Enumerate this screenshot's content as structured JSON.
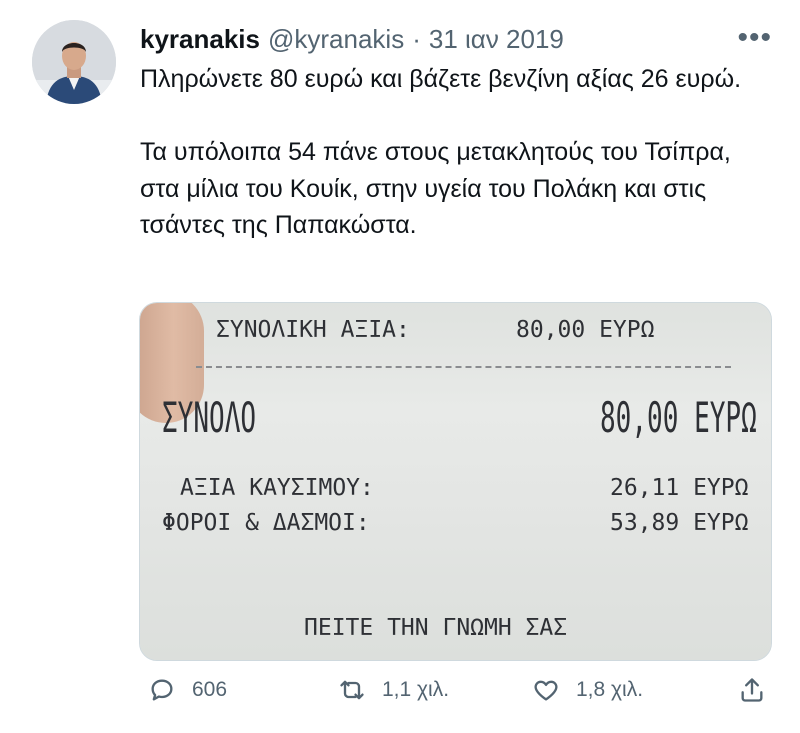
{
  "tweet": {
    "display_name": "kyranakis",
    "handle": "@kyranakis",
    "separator": "·",
    "date": "31 ιαν 2019",
    "more": "•••",
    "paragraphs": [
      "Πληρώνετε 80 ευρώ και βάζετε βενζίνη αξίας 26 ευρώ.",
      "Τα υπόλοιπα 54 πάνε στους μετακλητούς του Τσίπρα, στα μίλια του Κουίκ, στην υγεία του Πολάκη και στις τσάντες της Παπακώστα."
    ]
  },
  "receipt": {
    "total_value_label": "ΣΥΝΟΛΙΚΗ ΑΞΙΑ:",
    "total_value": "80,00 ΕΥΡΩ",
    "sum_label": "ΣΥΝΟΛΟ",
    "sum_value": "80,00 ΕΥΡΩ",
    "fuel_label": "ΑΞΙΑ ΚΑΥΣΙΜΟΥ:",
    "fuel_value": "26,11 ΕΥΡΩ",
    "tax_label": "ΦΟΡΟΙ & ΔΑΣΜΟΙ:",
    "tax_value": "53,89 ΕΥΡΩ",
    "footer": "ΠΕΙΤΕ ΤΗΝ ΓΝΩΜΗ ΣΑΣ"
  },
  "actions": {
    "replies": "606",
    "retweets": "1,1 χιλ.",
    "likes": "1,8 χιλ."
  },
  "icons": {
    "reply": "reply-icon",
    "retweet": "retweet-icon",
    "like": "heart-icon",
    "share": "share-icon",
    "more": "more-icon"
  }
}
